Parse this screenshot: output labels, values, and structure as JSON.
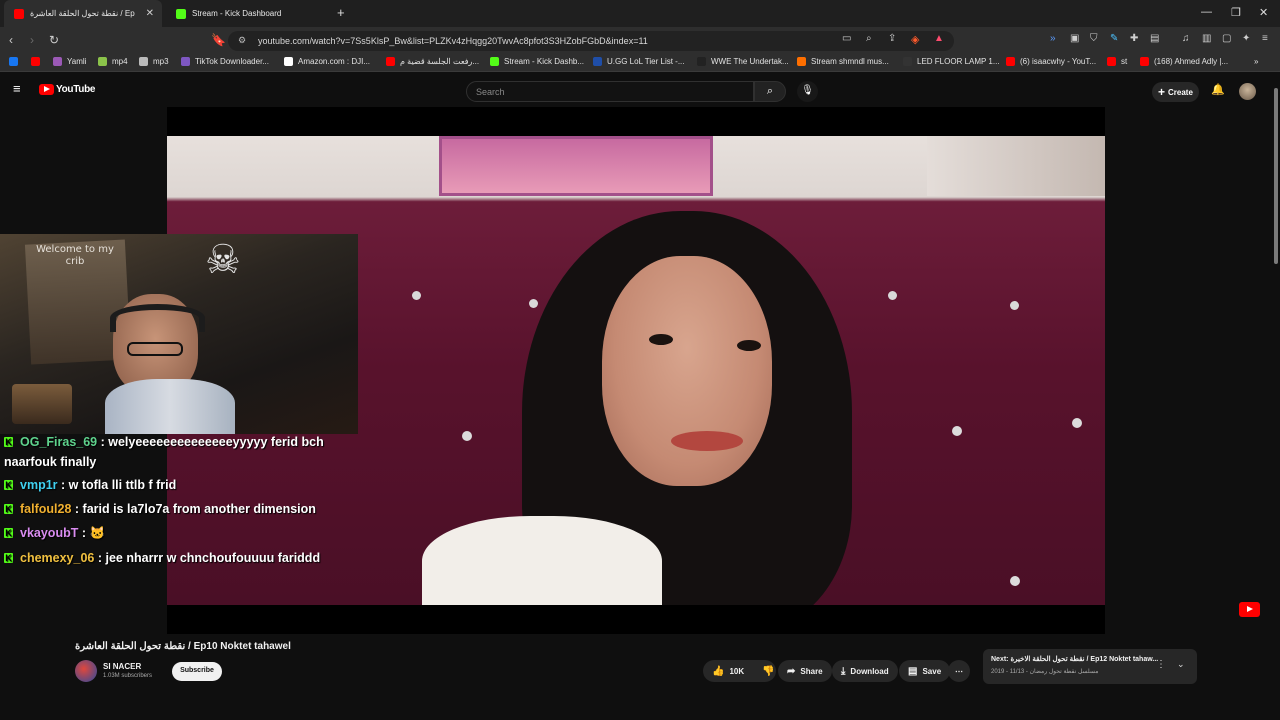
{
  "browser": {
    "tabs": [
      {
        "label": "نقطة تحول الحلقة العاشرة / Ep",
        "active": true,
        "icon": "youtube-icon"
      },
      {
        "label": "Stream - Kick Dashboard",
        "active": false,
        "icon": "kick-icon"
      }
    ],
    "new_tab": "+",
    "window": {
      "minimize": "—",
      "maximize": "❐",
      "close": "✕"
    },
    "url": "youtube.com/watch?v=7Ss5KlsP_Bw&list=PLZKv4zHqgg20TwvAc8pfot3S3HZobFGbD&index=11",
    "bookmarks": [
      {
        "label": "",
        "color": "#1877f2"
      },
      {
        "label": "",
        "color": "#ff0000"
      },
      {
        "label": "Yamli",
        "color": "#9b59b6"
      },
      {
        "label": "mp4",
        "color": "#8bc34a"
      },
      {
        "label": "mp3",
        "color": "#bbbbbb"
      },
      {
        "label": "TikTok Downloader...",
        "color": "#7e57c2"
      },
      {
        "label": "Amazon.com : DJI...",
        "color": "#ffffff"
      },
      {
        "label": "رفعت الجلسة قضية م...",
        "color": "#ff0000"
      },
      {
        "label": "Stream - Kick Dashb...",
        "color": "#53fc18"
      },
      {
        "label": "U.GG LoL Tier List -...",
        "color": "#1f4ea8"
      },
      {
        "label": "WWE The Undertak...",
        "color": "#222222"
      },
      {
        "label": "Stream shmndl mus...",
        "color": "#ff6f00"
      },
      {
        "label": "LED FLOOR LAMP 1...",
        "color": "#333333"
      },
      {
        "label": "(6) isaacwhy - YouT...",
        "color": "#ff0000"
      },
      {
        "label": "st",
        "color": "#ff0000"
      },
      {
        "label": "(168) Ahmed Adly |...",
        "color": "#ff0000"
      }
    ]
  },
  "youtube": {
    "logo": "YouTube",
    "search_placeholder": "Search",
    "create_label": "Create"
  },
  "overlay": {
    "webcam_sign": "Welcome to my crib",
    "chat": [
      {
        "user": "OG_Firas_69",
        "color": "#5fd38d",
        "text": ": welyeeeeeeeeeeeeeeyyyyy ferid bch naarfouk finally"
      },
      {
        "user": "vmp1r",
        "color": "#3fd0f0",
        "text": ": w tofla lli ttlb f frid"
      },
      {
        "user": "falfoul28",
        "color": "#f0b030",
        "text": ": farid is la7lo7a from another dimension"
      },
      {
        "user": "vkayoubT",
        "color": "#d98cf0",
        "text": ": 🐱"
      },
      {
        "user": "chemexy_06",
        "color": "#f0c040",
        "text": ": jee nharrr w chnchoufouuuu fariddd"
      }
    ]
  },
  "video": {
    "title": "نقطة تحول الحلقة العاشرة / Ep10 Noktet tahawel",
    "channel": "SI NACER",
    "subscribers": "1.03M subscribers",
    "subscribe_label": "Subscribe",
    "likes": "10K",
    "share_label": "Share",
    "download_label": "Download",
    "save_label": "Save",
    "more_label": "⋯"
  },
  "next_card": {
    "prefix": "Next:",
    "title": "نقطة تحول الحلقة الاخيرة / Ep12 Noktet tahaw...",
    "meta": "2019 - مسلسل نقطة تحول رمضان - 11/13"
  }
}
